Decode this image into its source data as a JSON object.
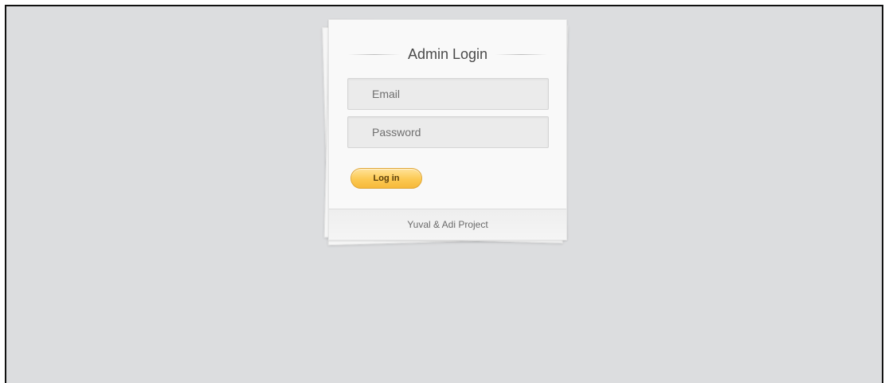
{
  "login_panel": {
    "title": "Admin Login",
    "email_placeholder": "Email",
    "password_placeholder": "Password",
    "login_button_label": "Log in",
    "footer_text": "Yuval & Adi Project"
  },
  "colors": {
    "background": "#dcdddf",
    "button_accent": "#fcc952"
  }
}
